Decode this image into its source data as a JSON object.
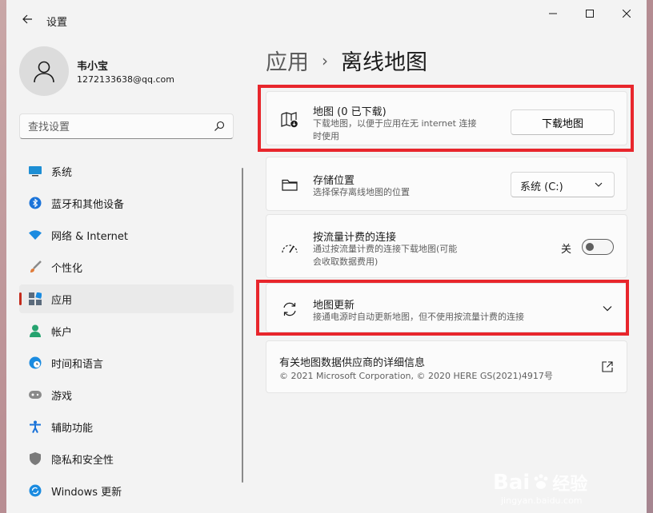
{
  "window": {
    "title": "设置"
  },
  "user": {
    "name": "韦小宝",
    "email": "1272133638@qq.com"
  },
  "search": {
    "placeholder": "查找设置"
  },
  "nav": {
    "items": [
      {
        "label": "系统",
        "icon": "monitor-icon"
      },
      {
        "label": "蓝牙和其他设备",
        "icon": "bluetooth-icon"
      },
      {
        "label": "网络 & Internet",
        "icon": "wifi-icon"
      },
      {
        "label": "个性化",
        "icon": "brush-icon"
      },
      {
        "label": "应用",
        "icon": "apps-icon",
        "active": true
      },
      {
        "label": "帐户",
        "icon": "person-icon"
      },
      {
        "label": "时间和语言",
        "icon": "globe-clock-icon"
      },
      {
        "label": "游戏",
        "icon": "gamepad-icon"
      },
      {
        "label": "辅助功能",
        "icon": "accessibility-icon"
      },
      {
        "label": "隐私和安全性",
        "icon": "shield-icon"
      },
      {
        "label": "Windows 更新",
        "icon": "update-icon"
      }
    ]
  },
  "breadcrumb": {
    "parent": "应用",
    "separator": "›",
    "current": "离线地图"
  },
  "cards": {
    "maps": {
      "title": "地图 (0 已下载)",
      "desc_line1": "下载地图，以便于应用在无 internet 连接",
      "desc_line2": "时使用",
      "button": "下载地图"
    },
    "storage": {
      "title": "存储位置",
      "desc": "选择保存离线地图的位置",
      "dropdown_value": "系统 (C:)"
    },
    "metered": {
      "title": "按流量计费的连接",
      "desc_line1": "通过按流量计费的连接下载地图(可能",
      "desc_line2": "会收取数据费用)",
      "toggle_label": "关",
      "toggle_on": false
    },
    "updates": {
      "title": "地图更新",
      "desc": "接通电源时自动更新地图，但不使用按流量计费的连接"
    },
    "provider": {
      "title": "有关地图数据供应商的详细信息",
      "desc": "© 2021 Microsoft Corporation, © 2020 HERE GS(2021)4917号"
    }
  },
  "watermark": {
    "brand": "Bai",
    "brand_cn": "经验",
    "url": "jingyan.baidu.com"
  },
  "colors": {
    "accent": "#c42b1c",
    "highlight": "#e8262c",
    "background": "#f3f3f3"
  }
}
